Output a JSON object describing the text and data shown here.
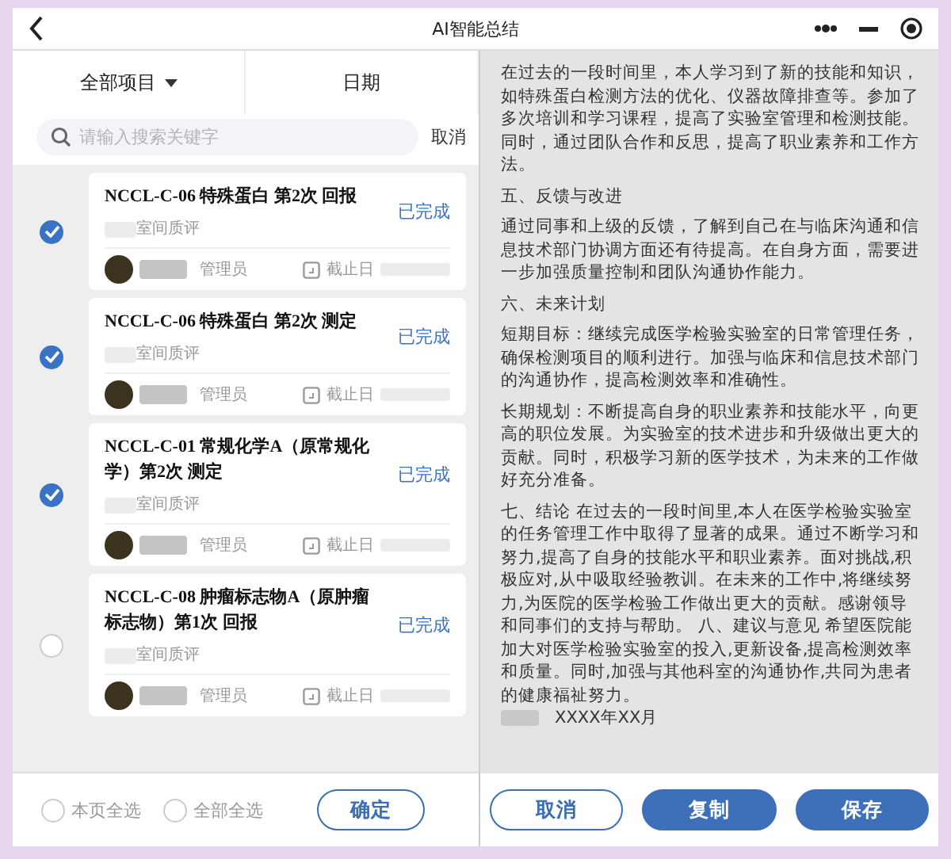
{
  "window": {
    "title": "AI智能总结"
  },
  "filters": [
    {
      "label": "全部项目",
      "dropdown": true
    },
    {
      "label": "日期",
      "dropdown": false
    }
  ],
  "search": {
    "placeholder": "请输入搜索关键字",
    "cancel": "取消"
  },
  "cards": [
    {
      "title": "NCCL-C-06 特殊蛋白 第2次 回报",
      "status": "已完成",
      "category": "室间质评",
      "role": "管理员",
      "deadline_label": "截止日",
      "selected": true
    },
    {
      "title": "NCCL-C-06 特殊蛋白 第2次 测定",
      "status": "已完成",
      "category": "室间质评",
      "role": "管理员",
      "deadline_label": "截止日",
      "selected": true
    },
    {
      "title": "NCCL-C-01 常规化学A（原常规化学）第2次 测定",
      "status": "已完成",
      "category": "室间质评",
      "role": "管理员",
      "deadline_label": "截止日",
      "selected": true
    },
    {
      "title": "NCCL-C-08 肿瘤标志物A（原肿瘤标志物）第1次 回报",
      "status": "已完成",
      "category": "室间质评",
      "role": "管理员",
      "deadline_label": "截止日",
      "selected": false
    }
  ],
  "select_options": [
    {
      "label": "本页全选",
      "checked": false
    },
    {
      "label": "全部全选",
      "checked": false
    }
  ],
  "confirm_button": "确定",
  "summary": [
    "在过去的一段时间里，本人学习到了新的技能和知识，如特殊蛋白检测方法的优化、仪器故障排查等。参加了多次培训和学习课程，提高了实验室管理和检测技能。同时，通过团队合作和反思，提高了职业素养和工作方法。",
    "五、反馈与改进",
    "通过同事和上级的反馈，了解到自己在与临床沟通和信息技术部门协调方面还有待提高。在自身方面，需要进一步加强质量控制和团队沟通协作能力。",
    "六、未来计划",
    "短期目标：继续完成医学检验实验室的日常管理任务，确保检测项目的顺利进行。加强与临床和信息技术部门的沟通协作，提高检测效率和准确性。",
    "长期规划：不断提高自身的职业素养和技能水平，向更高的职位发展。为实验室的技术进步和升级做出更大的贡献。同时，积极学习新的医学技术，为未来的工作做好充分准备。"
  ],
  "conclusion": "七、结论 在过去的一段时间里,本人在医学检验实验室的任务管理工作中取得了显著的成果。通过不断学习和努力,提高了自身的技能水平和职业素养。面对挑战,积极应对,从中吸取经验教训。在未来的工作中,将继续努力,为医院的医学检验工作做出更大的贡献。感谢领导和同事们的支持与帮助。 八、建议与意见 希望医院能加大对医学检验实验室的投入,更新设备,提高检测效率和质量。同时,加强与其他科室的沟通协作,共同为患者的健康福祉努力。",
  "date": "XXXX年XX月",
  "actions": [
    {
      "label": "取消",
      "kind": "outline"
    },
    {
      "label": "复制",
      "kind": "filled"
    },
    {
      "label": "保存",
      "kind": "filled"
    }
  ]
}
